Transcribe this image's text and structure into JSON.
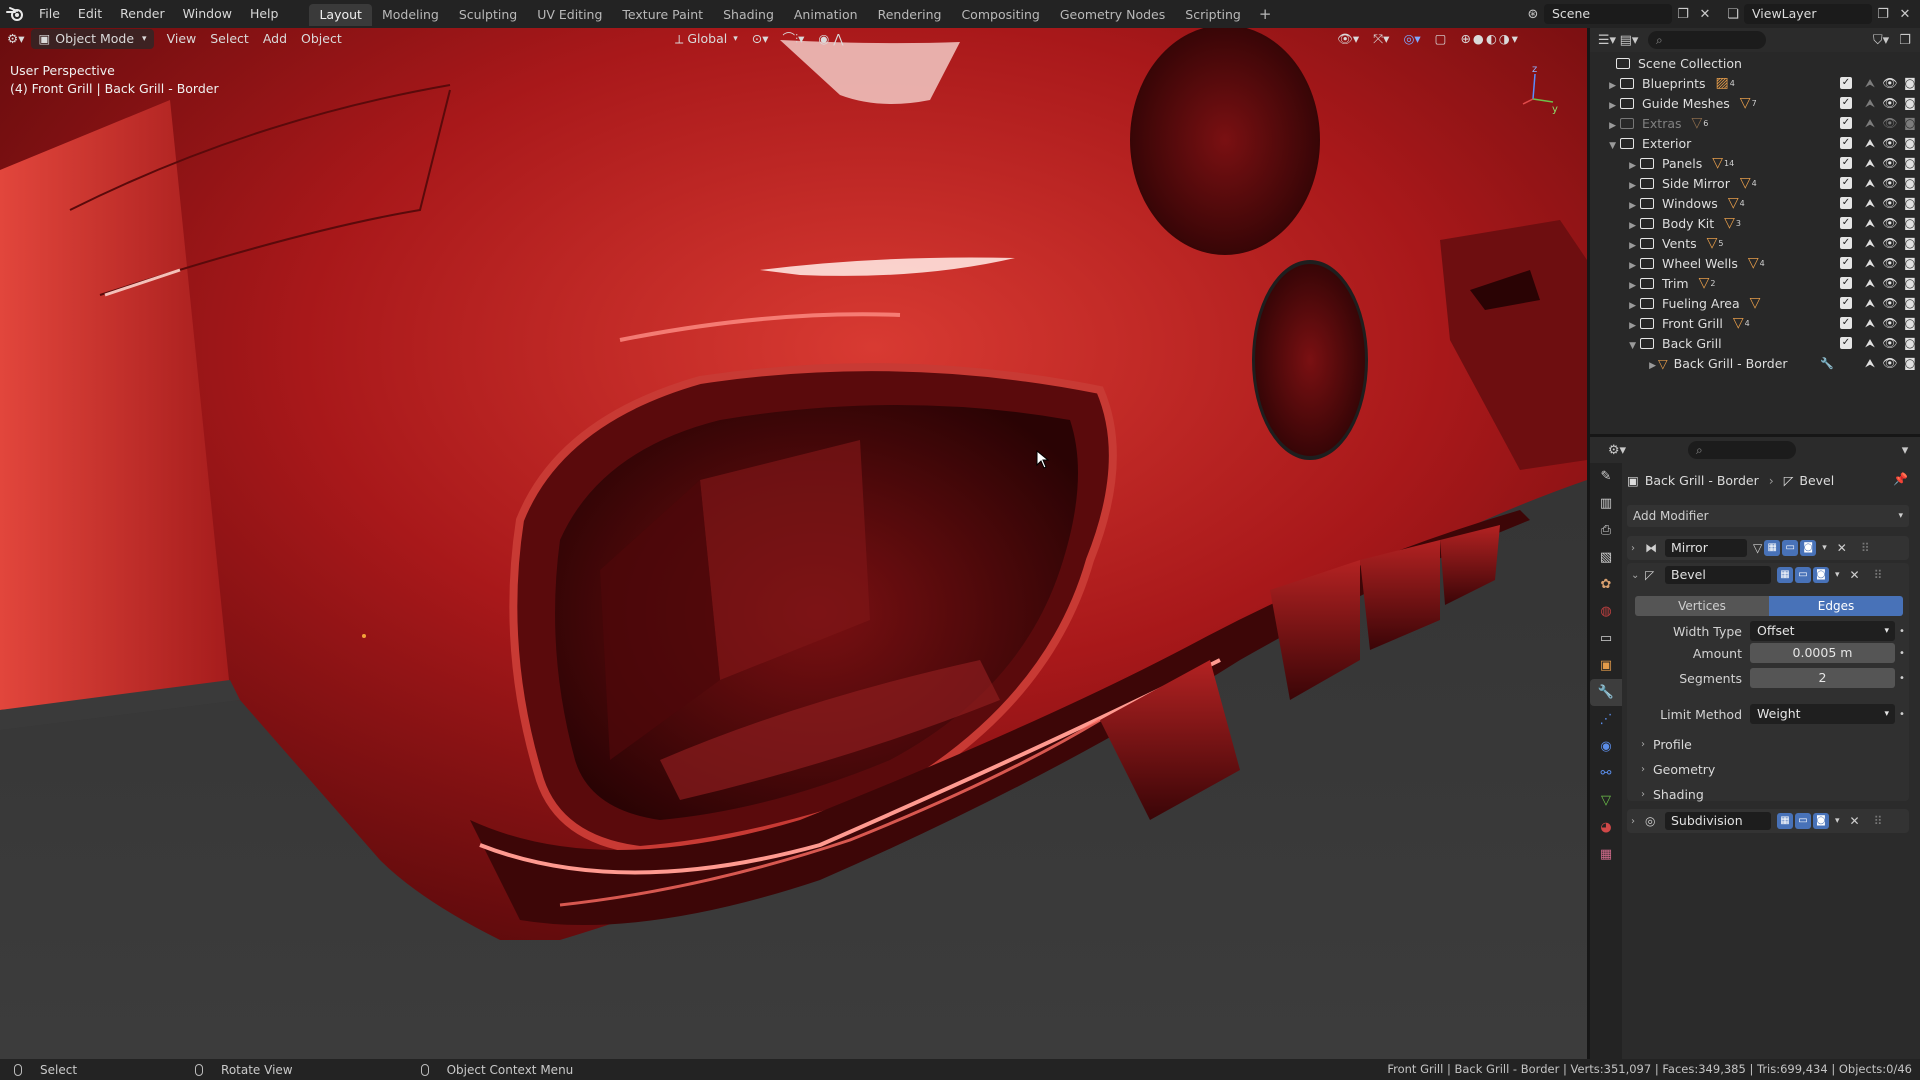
{
  "menu": [
    "File",
    "Edit",
    "Render",
    "Window",
    "Help"
  ],
  "workspaces": [
    "Layout",
    "Modeling",
    "Sculpting",
    "UV Editing",
    "Texture Paint",
    "Shading",
    "Animation",
    "Rendering",
    "Compositing",
    "Geometry Nodes",
    "Scripting"
  ],
  "active_workspace": "Layout",
  "scene": "Scene",
  "view_layer": "ViewLayer",
  "viewport_header": {
    "mode": "Object Mode",
    "menus": [
      "View",
      "Select",
      "Add",
      "Object"
    ],
    "transform_orientation": "Global"
  },
  "viewport": {
    "view_name": "User Perspective",
    "object_info": "(4) Front Grill | Back Grill - Border",
    "gizmo_axes": [
      "z",
      "y"
    ]
  },
  "outliner": {
    "root": "Scene Collection",
    "items": [
      {
        "name": "Blueprints",
        "count": "4",
        "icon": "image-icon",
        "dim": false
      },
      {
        "name": "Guide Meshes",
        "count": "7",
        "icon": "mesh-icon",
        "dim": false
      },
      {
        "name": "Extras",
        "count": "6",
        "icon": "mesh-icon",
        "dim": true
      },
      {
        "name": "Exterior",
        "count": "",
        "icon": "",
        "dim": false
      },
      {
        "name": "Panels",
        "count": "14",
        "icon": "mesh-icon",
        "dim": false
      },
      {
        "name": "Side Mirror",
        "count": "4",
        "icon": "mesh-icon",
        "dim": false
      },
      {
        "name": "Windows",
        "count": "4",
        "icon": "mesh-icon",
        "dim": false
      },
      {
        "name": "Body Kit",
        "count": "3",
        "icon": "mesh-icon",
        "dim": false
      },
      {
        "name": "Vents",
        "count": "5",
        "icon": "mesh-icon",
        "dim": false
      },
      {
        "name": "Wheel Wells",
        "count": "4",
        "icon": "mesh-icon",
        "dim": false
      },
      {
        "name": "Trim",
        "count": "2",
        "icon": "mesh-icon",
        "dim": false
      },
      {
        "name": "Fueling Area",
        "count": "",
        "icon": "mesh-icon",
        "dim": false
      },
      {
        "name": "Front Grill",
        "count": "4",
        "icon": "mesh-icon",
        "dim": false
      },
      {
        "name": "Back Grill",
        "count": "",
        "icon": "",
        "dim": false
      },
      {
        "name": "Back Grill - Border",
        "count": "",
        "icon": "mesh-icon",
        "dim": false
      }
    ]
  },
  "properties": {
    "breadcrumb_object": "Back Grill - Border",
    "breadcrumb_modifier": "Bevel",
    "add_modifier": "Add Modifier",
    "modifiers": {
      "mirror": "Mirror",
      "bevel": "Bevel",
      "subdivision": "Subdivision"
    },
    "bevel": {
      "affect_vertices": "Vertices",
      "affect_edges": "Edges",
      "affect_selected": "Edges",
      "width_type_label": "Width Type",
      "width_type": "Offset",
      "amount_label": "Amount",
      "amount": "0.0005 m",
      "segments_label": "Segments",
      "segments": "2",
      "limit_method_label": "Limit Method",
      "limit_method": "Weight",
      "subpanels": [
        "Profile",
        "Geometry",
        "Shading"
      ]
    }
  },
  "statusbar": {
    "select": "Select",
    "rotate": "Rotate View",
    "context": "Object Context Menu",
    "stats": "Front Grill | Back Grill - Border | Verts:351,097 | Faces:349,385 | Tris:699,434 | Objects:0/46"
  },
  "colors": {
    "accent_blue": "#4872b8",
    "car_red": "#b81e1e",
    "mesh_orange": "#e39b4a"
  }
}
